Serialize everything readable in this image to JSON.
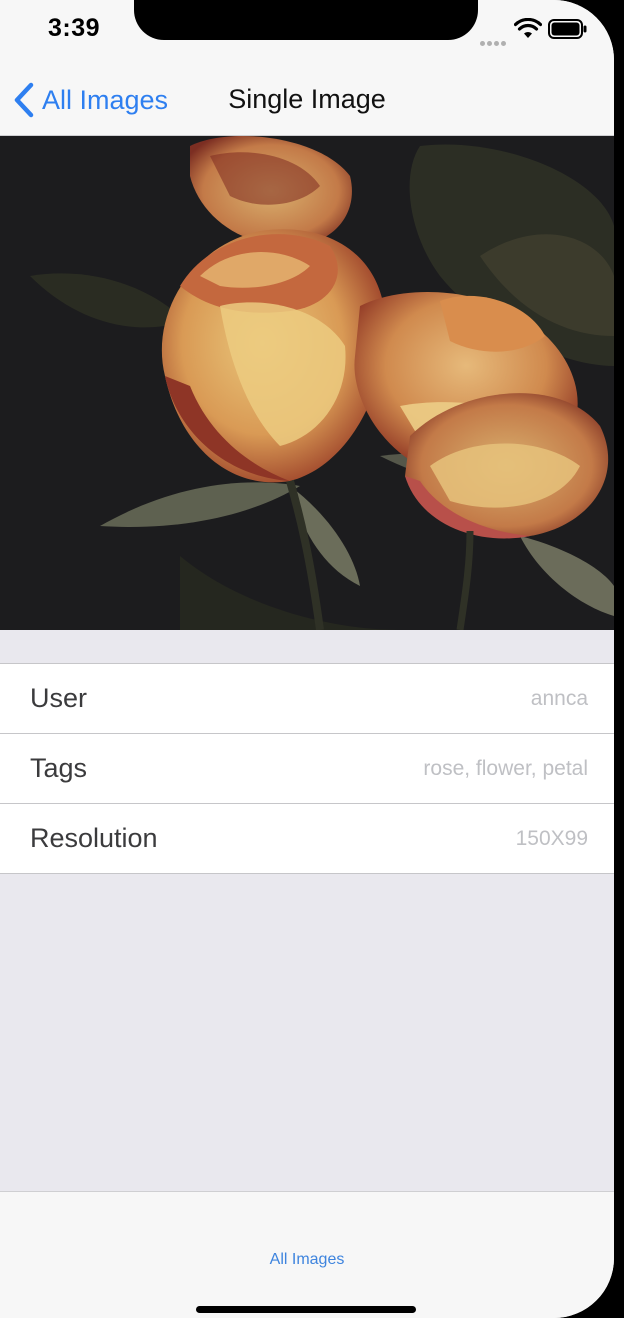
{
  "status_bar": {
    "time": "3:39"
  },
  "nav": {
    "back_label": "All Images",
    "title": "Single Image"
  },
  "photo": {
    "subject": "rose-photo"
  },
  "details": {
    "rows": [
      {
        "label": "User",
        "value": "annca"
      },
      {
        "label": "Tags",
        "value": "rose, flower, petal"
      },
      {
        "label": "Resolution",
        "value": "150X99"
      }
    ]
  },
  "tab_bar": {
    "items": [
      {
        "label": "All Images"
      }
    ]
  },
  "colors": {
    "accent": "#2e7ff0",
    "background": "#e9e8ee",
    "bar": "#f7f7f7"
  }
}
